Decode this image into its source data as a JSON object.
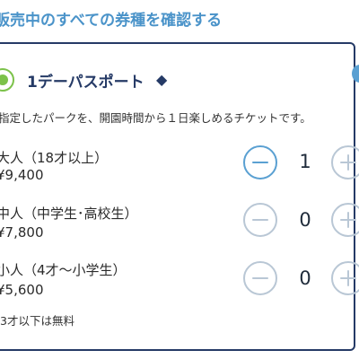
{
  "header": {
    "link_text": "販売中のすべての券種を確認する"
  },
  "ticket": {
    "title": "1デーパスポート",
    "diamond_icon": "◆",
    "description": "指定したパークを、開園時間から１日楽しめるチケットです。",
    "selected": true
  },
  "rows": [
    {
      "label": "大人（18才以上）",
      "price": "¥9,400",
      "quantity": "1",
      "minus_enabled": true,
      "plus_enabled": false
    },
    {
      "label": "中人（中学生･高校生）",
      "price": "¥7,800",
      "quantity": "0",
      "minus_enabled": false,
      "plus_enabled": false
    },
    {
      "label": "小人（4才〜小学生）",
      "price": "¥5,600",
      "quantity": "0",
      "minus_enabled": false,
      "plus_enabled": false
    }
  ],
  "footnote": "3才以下は無料",
  "colors": {
    "navy": "#253a66",
    "accent_blue": "#5aa0d2",
    "disabled_gray": "#b9c7d5",
    "radio_green": "#7cc24a"
  }
}
